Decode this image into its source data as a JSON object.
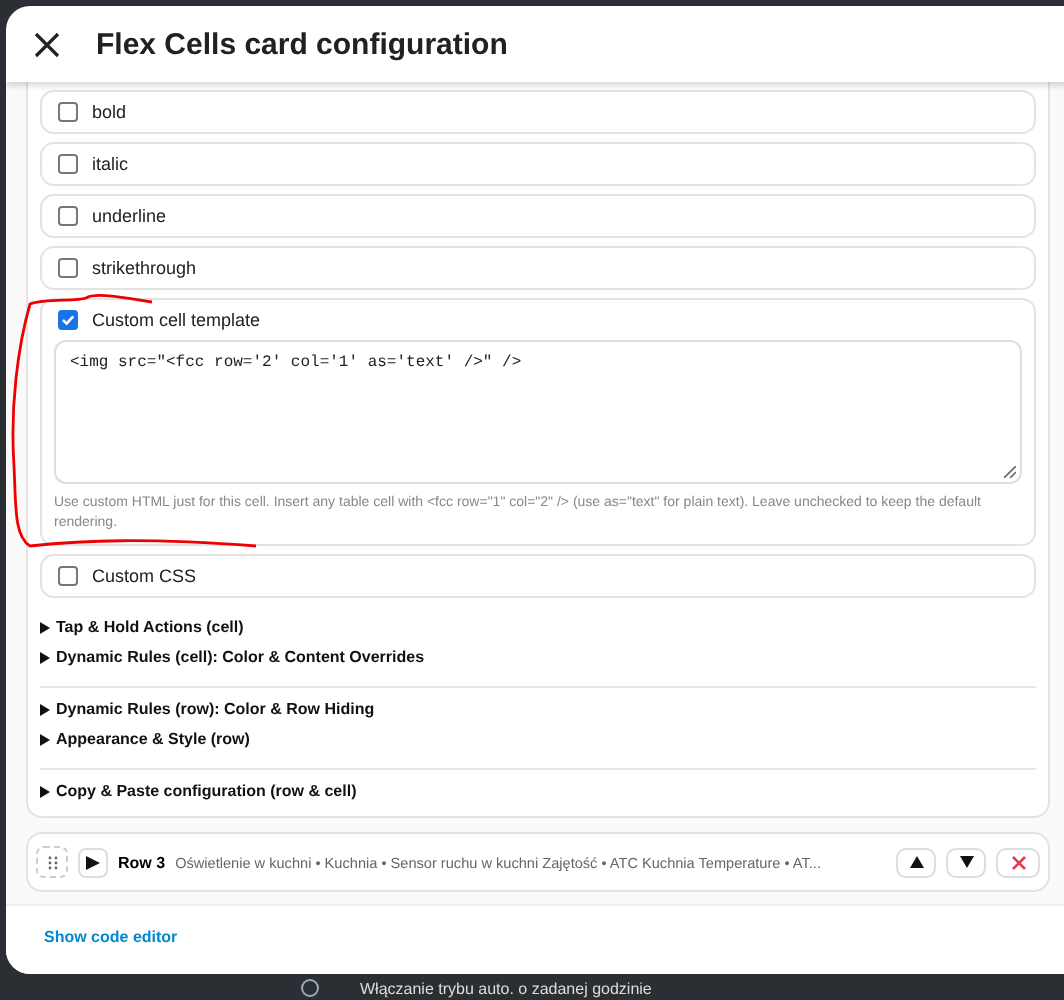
{
  "dialog": {
    "title": "Flex Cells card configuration"
  },
  "options": [
    {
      "label": "bold",
      "checked": false
    },
    {
      "label": "italic",
      "checked": false
    },
    {
      "label": "underline",
      "checked": false
    },
    {
      "label": "strikethrough",
      "checked": false
    },
    {
      "label": "Custom cell template",
      "checked": true,
      "value": "<img src=\"<fcc row='2' col='1' as='text' />\" />",
      "help": "Use custom HTML just for this cell. Insert any table cell with <fcc row=\"1\" col=\"2\" /> (use as=\"text\" for plain text). Leave unchecked to keep the default rendering."
    },
    {
      "label": "Custom CSS",
      "checked": false
    }
  ],
  "sections": [
    [
      {
        "label": "Tap & Hold Actions (cell)",
        "expanded": false
      },
      {
        "label": "Dynamic Rules (cell): Color & Content Overrides",
        "expanded": false
      }
    ],
    [
      {
        "label": "Dynamic Rules (row): Color & Row Hiding",
        "expanded": false
      },
      {
        "label": "Appearance & Style (row)",
        "expanded": false
      }
    ],
    [
      {
        "label": "Copy & Paste configuration (row & cell)",
        "expanded": false
      }
    ]
  ],
  "row": {
    "title": "Row 3",
    "summary": "Oświetlenie w kuchni • Kuchnia • Sensor ruchu w kuchni Zajętość • ATC Kuchnia Temperature • AT...",
    "expanded": false
  },
  "footer": {
    "link": "Show code editor"
  },
  "backdrop": {
    "text": "Włączanie trybu auto. o zadanej godzinie"
  }
}
